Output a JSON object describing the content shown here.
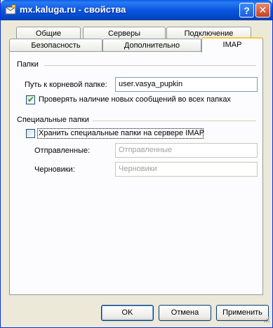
{
  "window": {
    "title": "mx.kaluga.ru - свойства",
    "help_label": "?",
    "close_label": "✕"
  },
  "tabs": {
    "row1": [
      "Общие",
      "Серверы",
      "Подключение"
    ],
    "row2": [
      "Безопасность",
      "Дополнительно",
      "IMAP"
    ],
    "active": "IMAP"
  },
  "folders_group": {
    "title": "Папки",
    "root_path_label": "Путь к корневой папке:",
    "root_path_value": "user.vasya_pupkin",
    "check_new_label": "Проверять наличие новых сообщений во всех папках",
    "check_new_checked": true
  },
  "special_group": {
    "title": "Специальные папки",
    "store_on_server_label": "Хранить специальные папки на сервере IMAP",
    "store_on_server_checked": false,
    "sent_label": "Отправленные:",
    "sent_value": "Отправленные",
    "drafts_label": "Черновики:",
    "drafts_value": "Черновики"
  },
  "buttons": {
    "ok": "OK",
    "cancel": "Отмена",
    "apply": "Применить"
  },
  "colors": {
    "titlebar": "#0a56e0",
    "tab_active_accent": "#ffc73c",
    "dialog_bg": "#ece9d8"
  }
}
